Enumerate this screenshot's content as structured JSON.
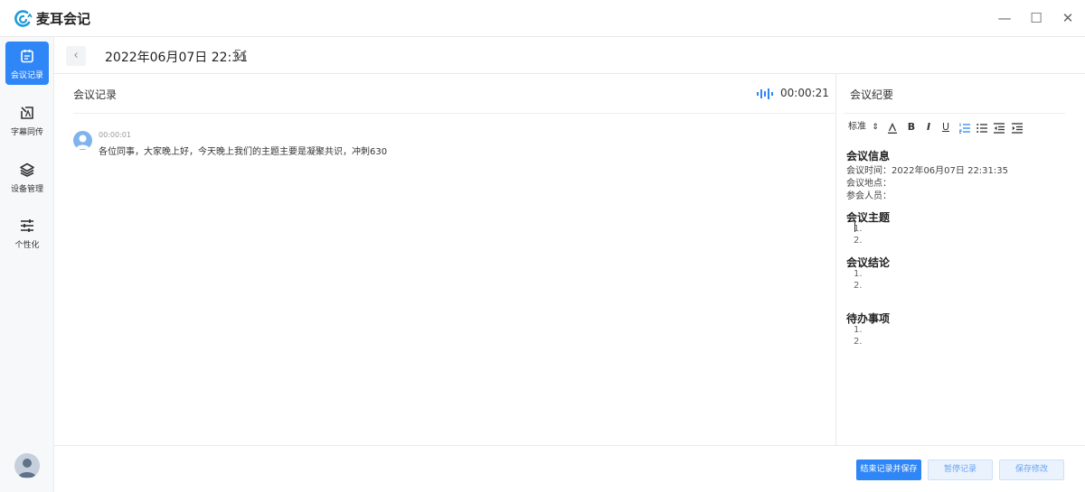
{
  "app": {
    "title": "麦耳会记"
  },
  "window": {
    "minimize": "—",
    "maximize": "☐",
    "close": "✕"
  },
  "sidebar": {
    "items": [
      {
        "label": "会议记录",
        "icon": "calendar-icon",
        "active": true
      },
      {
        "label": "字幕同传",
        "icon": "subtitle-icon",
        "active": false
      },
      {
        "label": "设备管理",
        "icon": "layers-icon",
        "active": false
      },
      {
        "label": "个性化",
        "icon": "sliders-icon",
        "active": false
      }
    ],
    "user_avatar": "user-avatar-icon"
  },
  "header": {
    "back": "‹",
    "title": "2022年06月07日 22:31"
  },
  "recording": {
    "title": "会议记录",
    "timer": "00:00:21",
    "entries": [
      {
        "time": "00:00:01",
        "text": "各位同事，大家晚上好，今天晚上我们的主题主要是凝聚共识，冲刺630"
      }
    ]
  },
  "summary": {
    "title": "会议纪要",
    "toolbar": {
      "style_select": "标准",
      "style_arrow": "⇕",
      "bold": "B",
      "italic": "I",
      "underline": "U"
    },
    "sections": {
      "info": {
        "heading": "会议信息",
        "time": "会议时间：2022年06月07日 22:31:35",
        "place": "会议地点：",
        "attendees": "参会人员："
      },
      "topic": {
        "heading": "会议主题",
        "items": [
          "1.",
          "2."
        ]
      },
      "conclusion": {
        "heading": "会议结论",
        "items": [
          "1.",
          "2."
        ]
      },
      "todo": {
        "heading": "待办事项",
        "items": [
          "1.",
          "2."
        ]
      }
    }
  },
  "footer": {
    "end_save": "结束记录并保存",
    "pause": "暂停记录",
    "save": "保存修改"
  },
  "colors": {
    "accent": "#2f86f6",
    "light_button": "#eaf2fd"
  }
}
